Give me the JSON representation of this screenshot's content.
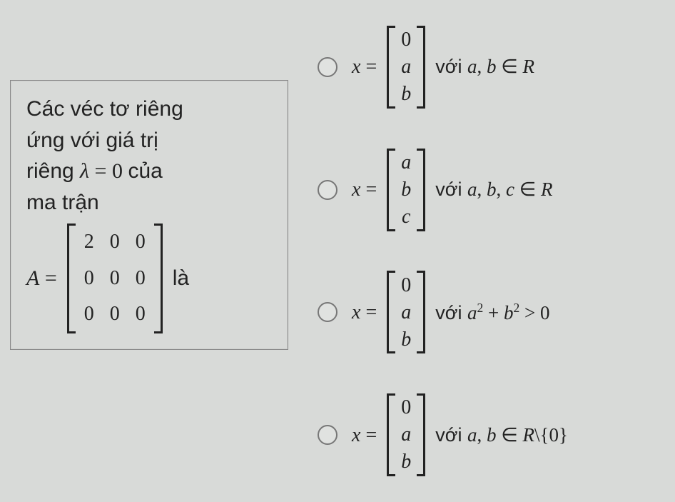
{
  "question": {
    "line1": "Các véc tơ riêng",
    "line2": "ứng với giá trị",
    "line3_pre": "riêng ",
    "lambda": "λ",
    "eq0": " = 0 ",
    "line3_post": "của",
    "line4": "ma trận",
    "A": "A",
    "equals": " = ",
    "matrix": [
      [
        "2",
        "0",
        "0"
      ],
      [
        "0",
        "0",
        "0"
      ],
      [
        "0",
        "0",
        "0"
      ]
    ],
    "la": "là"
  },
  "options": [
    {
      "x": "x",
      "eq": " = ",
      "vec": [
        "0",
        "a",
        "b"
      ],
      "vec_italic": [
        false,
        true,
        true
      ],
      "voi": "với  ",
      "cond_html": "a, b ∈ R"
    },
    {
      "x": "x",
      "eq": " = ",
      "vec": [
        "a",
        "b",
        "c"
      ],
      "vec_italic": [
        true,
        true,
        true
      ],
      "voi": "với  ",
      "cond_html": "a, b, c ∈ R"
    },
    {
      "x": "x",
      "eq": " = ",
      "vec": [
        "0",
        "a",
        "b"
      ],
      "vec_italic": [
        false,
        true,
        true
      ],
      "voi": "với  ",
      "cond_html": "a² + b² > 0"
    },
    {
      "x": "x",
      "eq": " = ",
      "vec": [
        "0",
        "a",
        "b"
      ],
      "vec_italic": [
        false,
        true,
        true
      ],
      "voi": "với  ",
      "cond_html": "a, b ∈ R\\{0}"
    }
  ]
}
